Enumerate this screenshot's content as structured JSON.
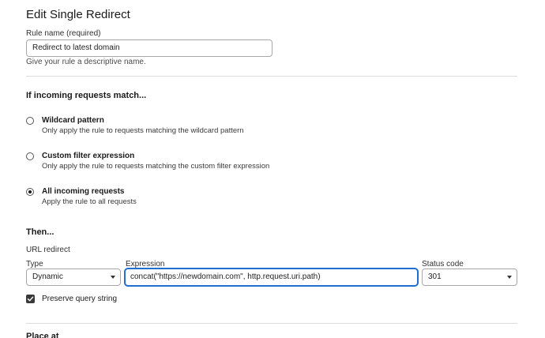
{
  "title": "Edit Single Redirect",
  "rule_name": {
    "label": "Rule name (required)",
    "value": "Redirect to latest domain",
    "helper": "Give your rule a descriptive name."
  },
  "match": {
    "heading": "If incoming requests match...",
    "options": [
      {
        "title": "Wildcard pattern",
        "desc": "Only apply the rule to requests matching the wildcard pattern",
        "checked": false
      },
      {
        "title": "Custom filter expression",
        "desc": "Only apply the rule to requests matching the custom filter expression",
        "checked": false
      },
      {
        "title": "All incoming requests",
        "desc": "Apply the rule to all requests",
        "checked": true
      }
    ]
  },
  "then": {
    "heading": "Then...",
    "action_label": "URL redirect",
    "type_label": "Type",
    "type_value": "Dynamic",
    "expression_label": "Expression",
    "expression_value": "concat(\"https://newdomain.com\", http.request.uri.path)",
    "status_label": "Status code",
    "status_value": "301",
    "preserve_label": "Preserve query string",
    "preserve_checked": true
  },
  "place_at": {
    "heading": "Place at"
  },
  "icons": {
    "checkmark": "check-icon",
    "select_caret": "chevron-down-icon"
  },
  "colors": {
    "focus_border": "#1f6fd1"
  }
}
